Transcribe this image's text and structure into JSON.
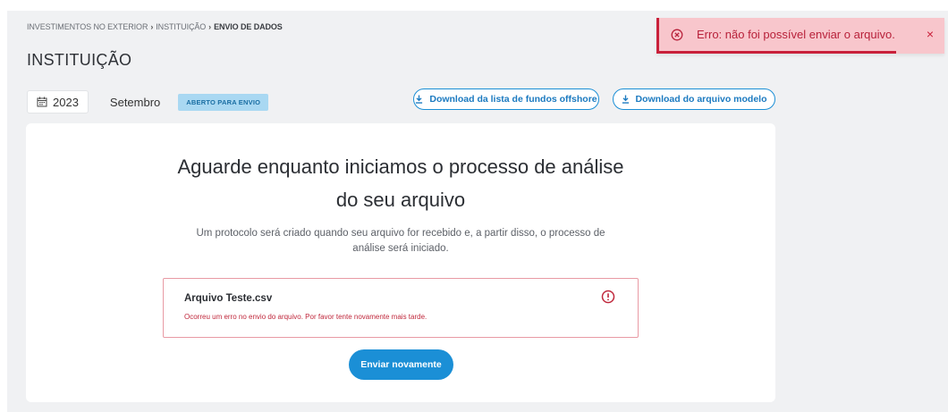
{
  "breadcrumb": {
    "items": [
      "INVESTIMENTOS NO EXTERIOR",
      "INSTITUIÇÃO",
      "ENVIO DE DADOS"
    ],
    "separator": "›"
  },
  "page_title": "INSTITUIÇÃO",
  "filters": {
    "year": "2023",
    "month": "Setembro",
    "status": "ABERTO PARA ENVIO"
  },
  "downloads": {
    "funds_list_label": "Download da lista de fundos offshore",
    "template_label": "Download do arquivo modelo"
  },
  "main": {
    "heading_line1": "Aguarde enquanto iniciamos o processo de análise",
    "heading_line2": "do seu arquivo",
    "description": "Um protocolo será criado quando seu arquivo for recebido e, a partir disso, o processo de análise será iniciado."
  },
  "file": {
    "name": "Arquivo Teste.csv",
    "error": "Ocorreu um erro no envio do arquivo. Por favor tente novamente mais tarde."
  },
  "retry_label": "Enviar novamente",
  "toast": {
    "message": "Erro: não foi possível enviar o arquivo.",
    "close_symbol": "×",
    "progress": 0.84
  },
  "colors": {
    "primary": "#1b8fd6",
    "error": "#c9203a",
    "toast_bg": "#f8c6cc",
    "badge_bg": "#a9d8f2"
  },
  "icons": [
    "calendar-icon",
    "download-icon",
    "alert-circle-icon",
    "error-circle-icon",
    "close-icon"
  ]
}
